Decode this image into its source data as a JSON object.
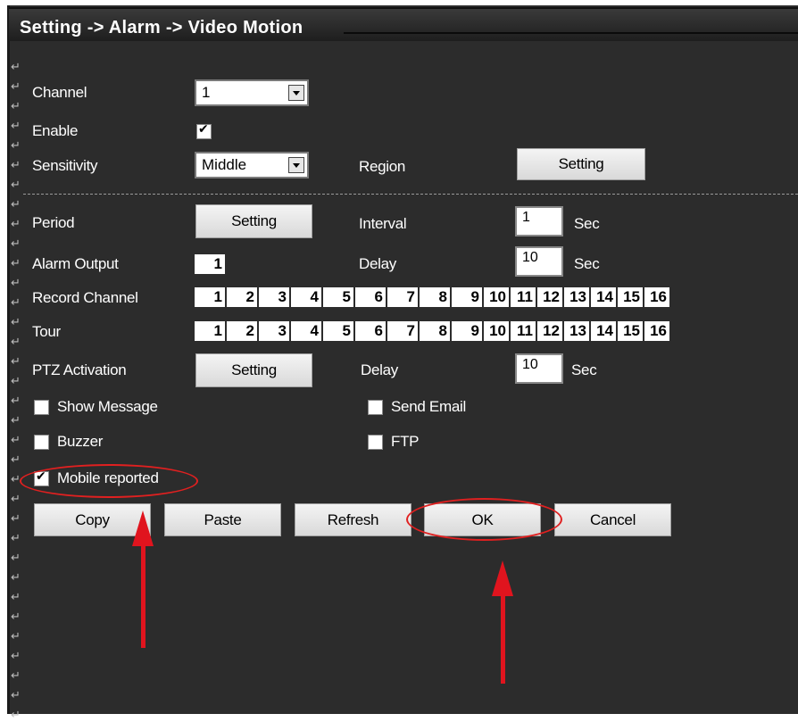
{
  "title": "Setting -> Alarm -> Video Motion",
  "form": {
    "channel": {
      "label": "Channel",
      "value": "1"
    },
    "enable": {
      "label": "Enable",
      "checked": true
    },
    "sensitivity": {
      "label": "Sensitivity",
      "value": "Middle"
    },
    "region": {
      "label": "Region",
      "button": "Setting"
    },
    "period": {
      "label": "Period",
      "button": "Setting"
    },
    "interval": {
      "label": "Interval",
      "value": "1",
      "unit": "Sec"
    },
    "alarm_output": {
      "label": "Alarm Output",
      "value": "1"
    },
    "delay1": {
      "label": "Delay",
      "value": "10",
      "unit": "Sec"
    },
    "record_channel": {
      "label": "Record Channel",
      "channels": [
        "1",
        "2",
        "3",
        "4",
        "5",
        "6",
        "7",
        "8",
        "9",
        "10",
        "11",
        "12",
        "13",
        "14",
        "15",
        "16"
      ]
    },
    "tour": {
      "label": "Tour",
      "channels": [
        "1",
        "2",
        "3",
        "4",
        "5",
        "6",
        "7",
        "8",
        "9",
        "10",
        "11",
        "12",
        "13",
        "14",
        "15",
        "16"
      ]
    },
    "ptz": {
      "label": "PTZ Activation",
      "button": "Setting"
    },
    "delay2": {
      "label": "Delay",
      "value": "10",
      "unit": "Sec"
    },
    "show_message": {
      "label": "Show Message",
      "checked": false
    },
    "send_email": {
      "label": "Send Email",
      "checked": false
    },
    "buzzer": {
      "label": "Buzzer",
      "checked": false
    },
    "ftp": {
      "label": "FTP",
      "checked": false
    },
    "mobile_reported": {
      "label": "Mobile reported",
      "checked": true
    }
  },
  "buttons": {
    "copy": "Copy",
    "paste": "Paste",
    "refresh": "Refresh",
    "ok": "OK",
    "cancel": "Cancel"
  },
  "colors": {
    "panel": "#2c2c2c",
    "annotation": "#e0141e"
  }
}
